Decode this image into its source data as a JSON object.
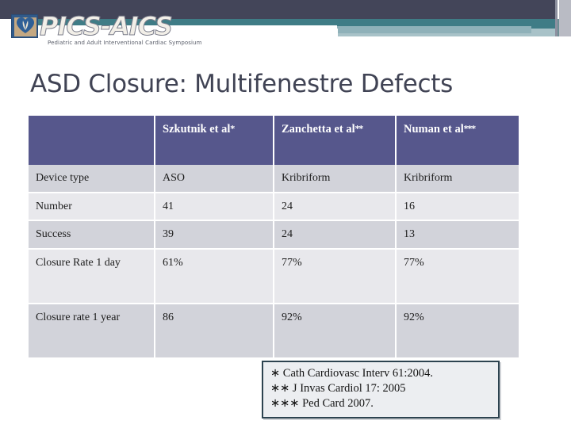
{
  "header": {
    "logo": {
      "wordmark": "PICS-AICS",
      "subtitle": "Pediatric and Adult Interventional Cardiac Symposium",
      "mark_icon": "heart-leaf-icon"
    },
    "colors": {
      "band_dark": "#434559",
      "band_teal": "#3f7c86",
      "band_light_teal": "#a8c2c8"
    }
  },
  "slide": {
    "title": "ASD Closure: Multifenestre Defects",
    "title_color": "#404354"
  },
  "table": {
    "header_bg": "#56578c",
    "row_odd_bg": "#d2d3da",
    "row_even_bg": "#e8e8ec",
    "columns": [
      {
        "label": "",
        "marker": ""
      },
      {
        "label": "Szkutnik et al",
        "marker": "*"
      },
      {
        "label": "Zanchetta et al",
        "marker": "**"
      },
      {
        "label": "Numan et al",
        "marker": "***"
      }
    ],
    "rows": [
      {
        "label": "Device type",
        "values": [
          "ASO",
          "Kribriform",
          "Kribriform"
        ]
      },
      {
        "label": "Number",
        "values": [
          "41",
          "24",
          "16"
        ]
      },
      {
        "label": "Success",
        "values": [
          "39",
          "24",
          "13"
        ]
      },
      {
        "label": "Closure Rate 1 day",
        "values": [
          "61%",
          "77%",
          "77%"
        ]
      },
      {
        "label": "Closure rate 1 year",
        "values": [
          "86",
          "92%",
          "92%"
        ]
      }
    ]
  },
  "footnotes": {
    "line1": "∗ Cath Cardiovasc Interv 61:2004.",
    "line2": "∗∗ J Invas Cardiol 17: 2005",
    "line3": "∗∗∗ Ped Card 2007."
  }
}
